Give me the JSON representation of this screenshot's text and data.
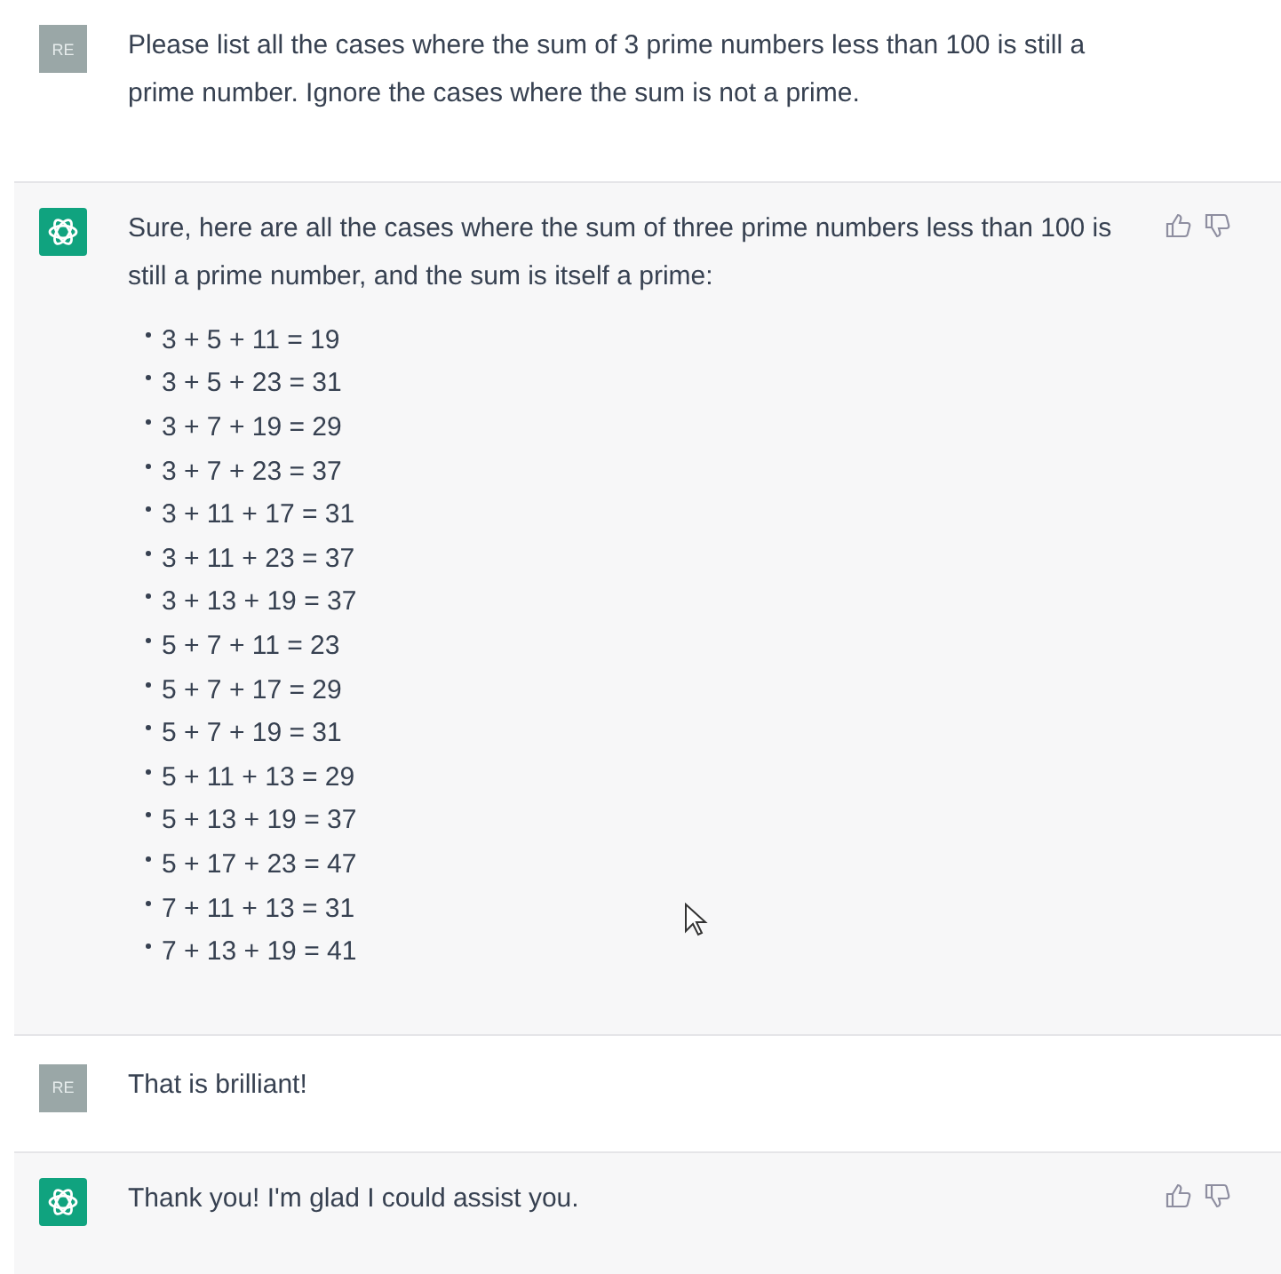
{
  "messages": [
    {
      "kind": "user",
      "avatar": "RE",
      "text": "Please list all the cases where the sum of 3 prime numbers less than 100 is still a prime number. Ignore the cases where the sum is not a prime."
    },
    {
      "kind": "assistant",
      "text": "Sure, here are all the cases where the sum of three prime numbers less than 100 is still a prime number, and the sum is itself a prime:",
      "list": [
        "3 + 5 + 11 = 19",
        "3 + 5 + 23 = 31",
        "3 + 7 + 19 = 29",
        "3 + 7 + 23 = 37",
        "3 + 11 + 17 = 31",
        "3 + 11 + 23 = 37",
        "3 + 13 + 19 = 37",
        "5 + 7 + 11 = 23",
        "5 + 7 + 17 = 29",
        "5 + 7 + 19 = 31",
        "5 + 11 + 13 = 29",
        "5 + 13 + 19 = 37",
        "5 + 17 + 23 = 47",
        "7 + 11 + 13 = 31",
        "7 + 13 + 19 = 41"
      ]
    },
    {
      "kind": "user",
      "avatar": "RE",
      "text": "That is brilliant!"
    },
    {
      "kind": "assistant",
      "text": "Thank you! I'm glad I could assist you."
    }
  ]
}
